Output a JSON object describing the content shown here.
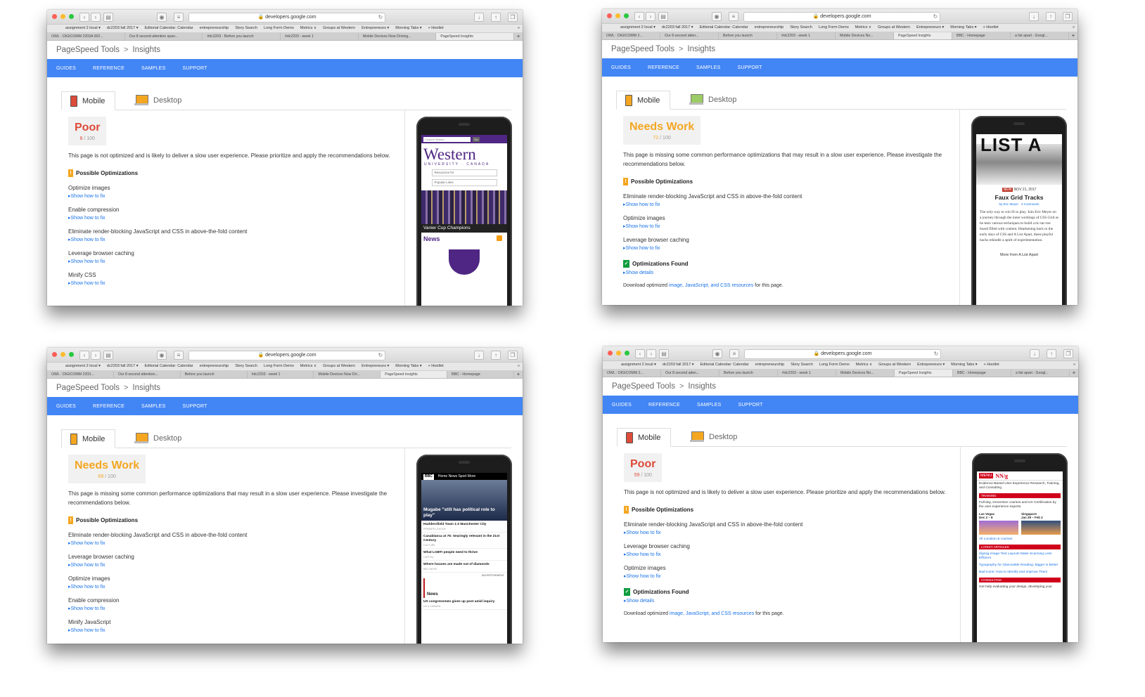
{
  "browser": {
    "url": "developers.google.com",
    "bookmarks": [
      "assignment 2 local ▾",
      "dc2203 fall 2017 ▾",
      "Editorial Calendar: Calendar",
      "entrepreneurship",
      "Story Search",
      "Long Form Demo",
      "Metrics ∨",
      "Groups at Western",
      "Entrepreneurs ▾",
      "Morning Tabs ▾",
      "+ Hootlet"
    ],
    "bookmarks_more": "»",
    "breadcrumb_root": "PageSpeed Tools",
    "breadcrumb_sep": ">",
    "breadcrumb_page": "Insights",
    "nav": [
      "GUIDES",
      "REFERENCE",
      "SAMPLES",
      "SUPPORT"
    ],
    "mobile_tab": "Mobile",
    "desktop_tab": "Desktop",
    "show_fix": "Show how to fix",
    "show_details": "Show details",
    "possible_title": "Possible Optimizations",
    "found_title": "Optimizations Found",
    "download_prefix": "Download optimized ",
    "download_link": "image, JavaScript, and CSS resources",
    "download_suffix": " for this page."
  },
  "windows": [
    {
      "tabs": [
        "OWL : DIGICOMM 2203A 002...",
        "Our 8 second attention span...",
        "#dc2203 - Before you launch",
        "#dc2203 - week 1",
        "Mobile Devices Now Driving...",
        "PageSpeed Insights"
      ],
      "active_tab": 5,
      "score_label": "Poor",
      "score_value": "8",
      "score_max": "/ 100",
      "score_color": "#dd4b39",
      "description": "This page is not optimized and is likely to deliver a slow user experience. Please prioritize and apply the recommendations below.",
      "rules": [
        "Optimize images",
        "Enable compression",
        "Eliminate render-blocking JavaScript and CSS in above-the-fold content",
        "Leverage browser caching",
        "Minify CSS"
      ],
      "found": false,
      "phone": {
        "search": "Custom Search",
        "go": "Go",
        "logo": "Western",
        "sub": "UNIVERSITY · CANADA",
        "select1": "Resources for",
        "select2": "Popular Links",
        "caption": "Vanier Cup Champions",
        "news": "News"
      }
    },
    {
      "tabs": [
        "OWL : DIGICOMM 2...",
        "Our 8 second atten...",
        "Before you launch",
        "#dc2203 - week 1",
        "Mobile Devices No...",
        "PageSpeed Insights",
        "BBC - Homepage",
        "a list apart - Googl..."
      ],
      "active_tab": 5,
      "score_label": "Needs Work",
      "score_value": "72",
      "score_max": "/ 100",
      "score_color": "#f4a621",
      "description": "This page is missing some common performance optimizations that may result in a slow user experience. Please investigate the recommendations below.",
      "rules": [
        "Eliminate render-blocking JavaScript and CSS in above-the-fold content",
        "Optimize images",
        "Leverage browser caching"
      ],
      "found": true,
      "phone": {
        "big": "LIST A",
        "new": "NEW",
        "date": "NOV 21, 2017",
        "title": "Faux Grid Tracks",
        "by": "by Eric Meyer · 3 Comments",
        "body": "The only way to win IS to play. Join Eric Meyer on a journey through the inner workings of CSS Grid as he tests various techniques to build a tic-tac-toe board filled with content. Hearkening back to the early days of CSS and A List Apart, these playful hacks rekindle a spirit of experimentation.",
        "more": "More from A List Apart"
      }
    },
    {
      "tabs": [
        "OWL : DIGICOMM 2203...",
        "Our 8 second attention...",
        "Before you launch",
        "#dc2203 - week 1",
        "Mobile Devices Now Dri...",
        "PageSpeed Insights",
        "BBC - Homepage"
      ],
      "active_tab": 5,
      "score_label": "Needs Work",
      "score_value": "68",
      "score_max": "/ 100",
      "score_color": "#f4a621",
      "description": "This page is missing some common performance optimizations that may result in a slow user experience. Please investigate the recommendations below.",
      "rules": [
        "Eliminate render-blocking JavaScript and CSS in above-the-fold content",
        "Leverage browser caching",
        "Optimize images",
        "Enable compression",
        "Minify JavaScript"
      ],
      "found": false,
      "phone": {
        "bbc": "BBC",
        "nav": "Home  News  Sport  More",
        "headline": "Mugabe \"still has political role to play\"",
        "items": [
          {
            "title": "Huddersfield Town 1-2 Manchester City",
            "tag": "PREMIER LEAGUE"
          },
          {
            "title": "Casablanca at 75: Searingly relevant in the 21st Century",
            "tag": "CULTURE"
          },
          {
            "title": "What LGBTI people need to thrive",
            "tag": "CAPITAL"
          },
          {
            "title": "Where houses are made out of diamonds",
            "tag": "BBC NEWS"
          }
        ],
        "ad": "ADVERTISEMENT",
        "news": "News",
        "news_item": "US congressmen gives up post amid inquiry",
        "news_tag": "US & CANADA"
      }
    },
    {
      "tabs": [
        "OWL : DIGICOMM 2...",
        "Our 8 second atten...",
        "Before you launch",
        "#dc2203 - week 1",
        "Mobile Devices No...",
        "PageSpeed Insights",
        "BBC - Homepage",
        "a list apart - Googl..."
      ],
      "active_tab": 5,
      "score_label": "Poor",
      "score_value": "59",
      "score_max": "/ 100",
      "score_color": "#dd4b39",
      "description": "This page is not optimized and is likely to deliver a slow user experience. Please prioritize and apply the recommendations below.",
      "rules": [
        "Eliminate render-blocking JavaScript and CSS in above-the-fold content",
        "Leverage browser caching",
        "Optimize images"
      ],
      "found": true,
      "phone": {
        "menu": "MENU",
        "logo": "NN/g",
        "intro": "Evidence-Based User Experience Research, Training, and Consulting",
        "training": "TRAINING",
        "training_text": "Full-day, immersive courses and UX Certification by the user experience experts.",
        "city1": "Las Vegas",
        "city1_date": "Dec 2 – 8",
        "city2": "Singapore",
        "city2_date": "Jan 29 – Feb 2",
        "all": "All Location & courses",
        "latest": "LATEST ARTICLES",
        "articles": [
          "Zigzag Image-Text Layouts Make Scanning Less Efficient",
          "Typography for Glanceable Reading: Bigger is Better",
          "Bad Icons: How to Identify and Improve Them"
        ],
        "consulting": "CONSULTING",
        "consulting_text": "Get help evaluating your design, developing your"
      }
    }
  ]
}
